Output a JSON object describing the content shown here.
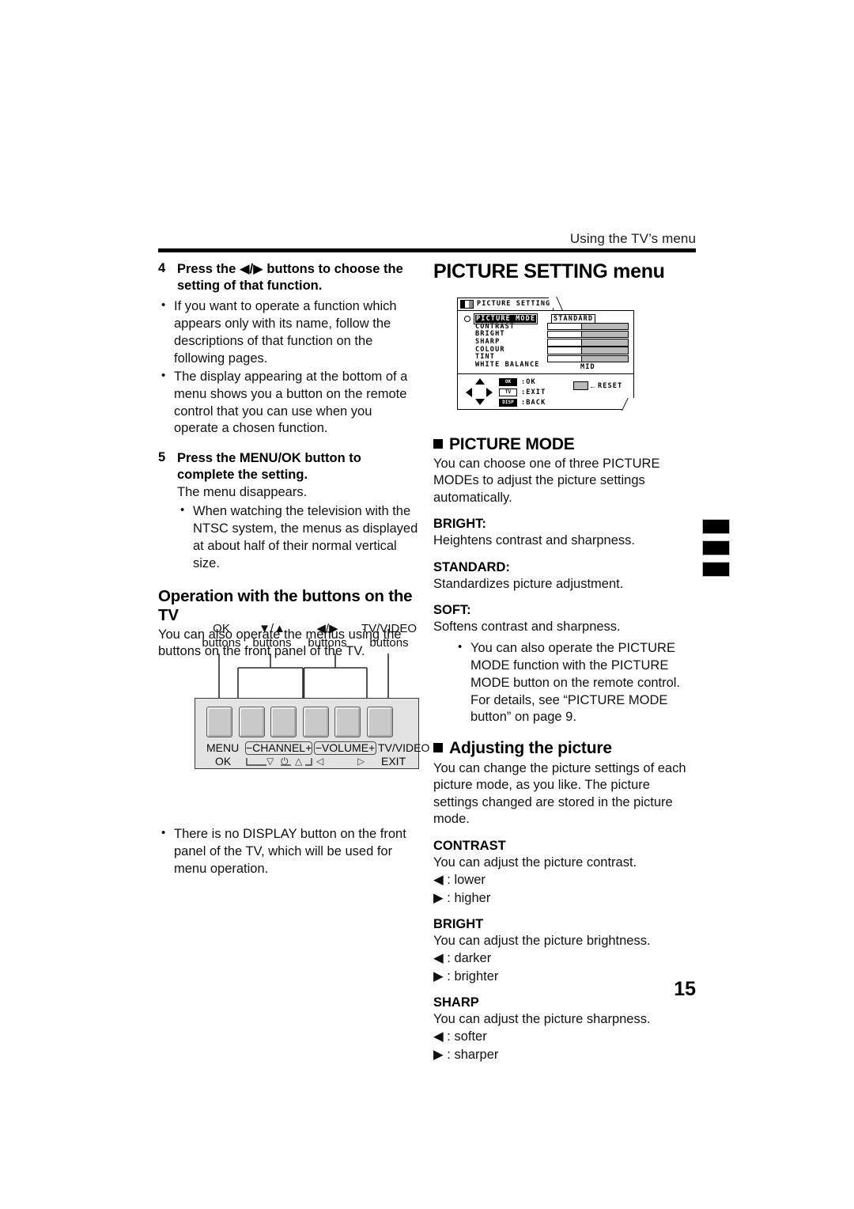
{
  "running_head": "Using the TV’s menu",
  "page_number": "15",
  "left_column": {
    "step4": {
      "number": "4",
      "title": "Press the ◀/▶ buttons to choose the setting of that function.",
      "bullets": [
        "If you want to operate a function which appears only with its name, follow the descriptions of that function on the following pages.",
        "The display appearing at the bottom of a menu shows you a button on the remote control that you can use when you operate a chosen function."
      ]
    },
    "step5": {
      "number": "5",
      "title": "Press the MENU/OK button to complete the setting.",
      "body": "The menu disappears.",
      "bullets": [
        "When watching the television with the NTSC system, the menus as displayed at about half of their normal vertical size."
      ]
    },
    "section": {
      "heading": "Operation with the buttons on the TV",
      "body": "You can also operate the menus using the buttons on the front panel of the TV.",
      "bullets": [
        "There is no DISPLAY button on the front panel of the TV, which will be used for menu operation."
      ]
    },
    "tv_panel": {
      "callouts": [
        {
          "line1": "OK",
          "line2": "buttons"
        },
        {
          "line1": "▼/▲",
          "line2": "buttons"
        },
        {
          "line1": "◀/▶",
          "line2": "buttons"
        },
        {
          "line1": "TV/VIDEO",
          "line2": "buttons"
        }
      ],
      "button_count": 6,
      "labels_row1": [
        "MENU",
        "−CHANNEL+",
        "−VOLUME+",
        "TV/VIDEO"
      ],
      "labels_row2": [
        "OK",
        "▽",
        "⏻",
        "△",
        "◁",
        "▷",
        "EXIT"
      ]
    }
  },
  "right_column": {
    "title": "PICTURE SETTING menu",
    "osd": {
      "tab_label": "PICTURE SETTING",
      "tab_icon": "picture-setting-icon",
      "rows": [
        {
          "label": "PICTURE MODE",
          "selected": true,
          "control": "value",
          "value": "STANDARD"
        },
        {
          "label": "CONTRAST",
          "selected": false,
          "control": "bar"
        },
        {
          "label": "BRIGHT",
          "selected": false,
          "control": "bar"
        },
        {
          "label": "SHARP",
          "selected": false,
          "control": "bar"
        },
        {
          "label": "COLOUR",
          "selected": false,
          "control": "bar"
        },
        {
          "label": "TINT",
          "selected": false,
          "control": "bar"
        },
        {
          "label": "WHITE BALANCE",
          "selected": false,
          "control": "value",
          "value": "MID"
        }
      ],
      "keys": [
        {
          "key": "OK",
          "action": ":OK"
        },
        {
          "key": "TV",
          "action": ":EXIT"
        },
        {
          "key": "DISP",
          "action": ":BACK"
        }
      ],
      "reset_label": "RESET",
      "reset_arrow": "←"
    },
    "picture_mode": {
      "heading": "PICTURE MODE",
      "intro": "You can choose one of three PICTURE MODEs to adjust the picture settings automatically.",
      "modes": [
        {
          "term": "BRIGHT:",
          "desc": "Heightens contrast and sharpness."
        },
        {
          "term": "STANDARD:",
          "desc": "Standardizes picture adjustment."
        },
        {
          "term": "SOFT:",
          "desc": "Softens contrast and sharpness."
        }
      ],
      "bullets": [
        "You can also operate the PICTURE MODE function with the PICTURE MODE button on the remote control. For details, see “PICTURE MODE button” on page 9."
      ]
    },
    "adjusting": {
      "heading": "Adjusting the picture",
      "intro": "You can change the picture settings of each picture mode, as you like. The picture settings changed are stored in the picture mode.",
      "items": [
        {
          "term": "CONTRAST",
          "desc": "You can adjust the picture contrast.",
          "left": "◀ : lower",
          "right": "▶ : higher"
        },
        {
          "term": "BRIGHT",
          "desc": "You can adjust the picture brightness.",
          "left": "◀ : darker",
          "right": "▶ : brighter"
        },
        {
          "term": "SHARP",
          "desc": "You can adjust the picture sharpness.",
          "left": "◀ : softer",
          "right": "▶ : sharper"
        }
      ]
    }
  },
  "edge_tabs": {
    "count": 3,
    "color": "#000000"
  }
}
